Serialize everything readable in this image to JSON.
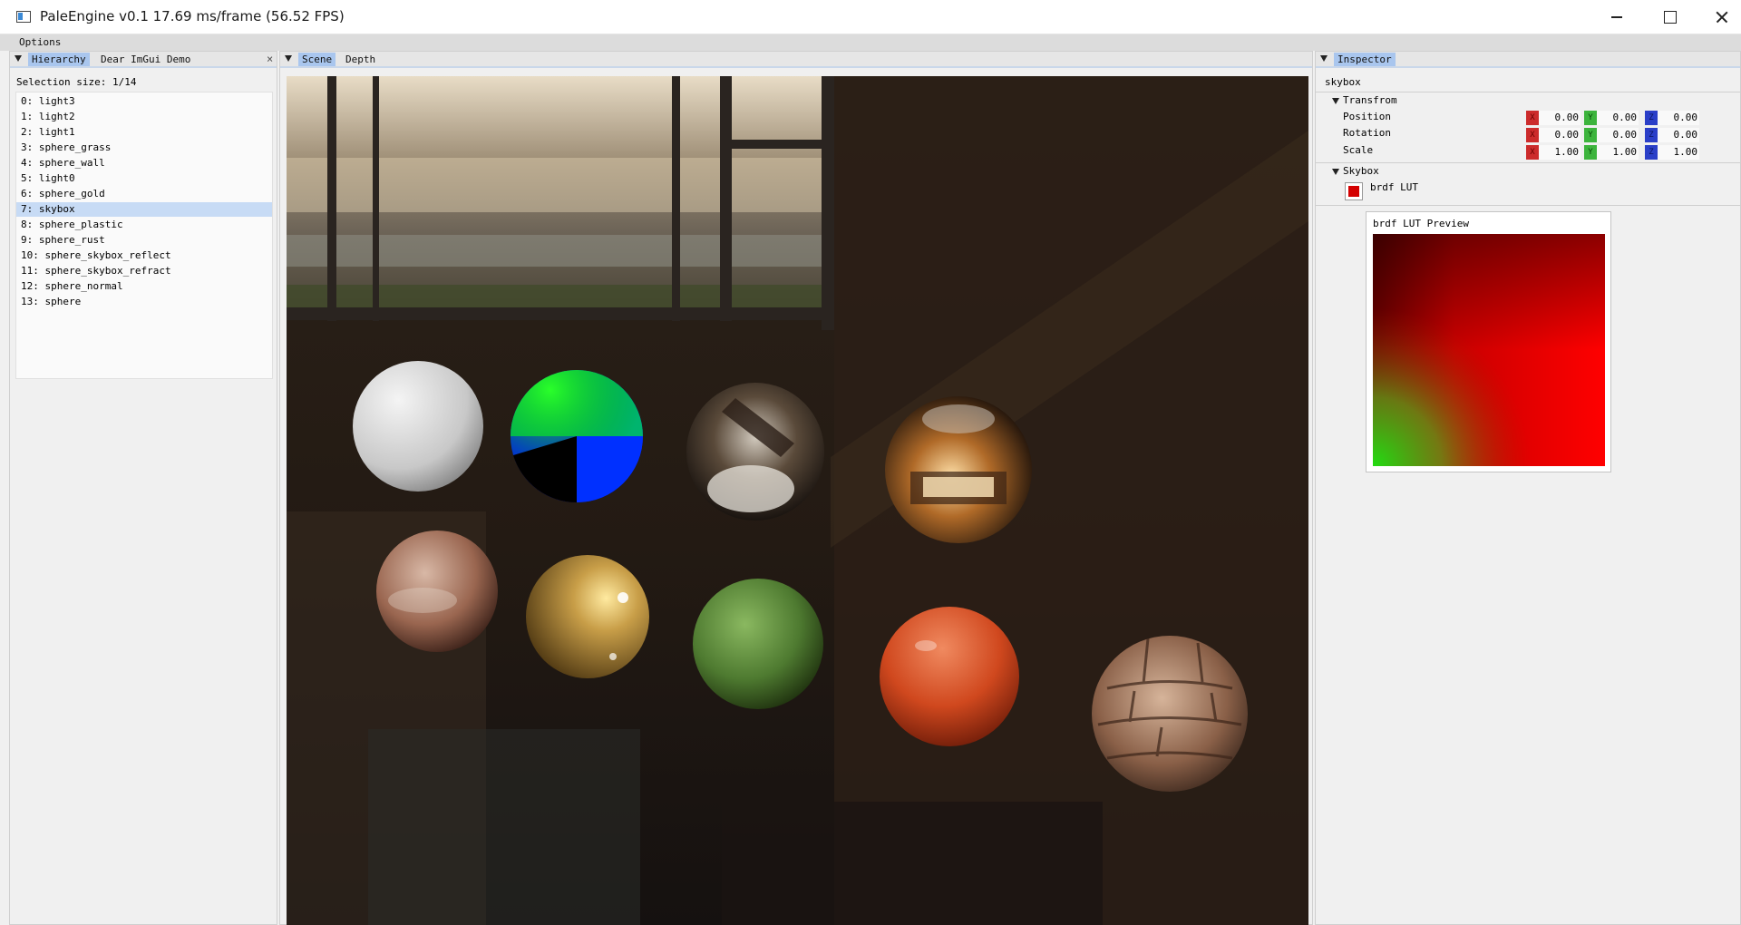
{
  "window": {
    "title": "PaleEngine v0.1 17.69 ms/frame (56.52 FPS)"
  },
  "menu": {
    "options": "Options"
  },
  "hierarchy_panel": {
    "tabs": [
      "Hierarchy",
      "Dear ImGui Demo"
    ],
    "selection_size": "Selection size: 1/14",
    "items": [
      "0: light3",
      "1: light2",
      "2: light1",
      "3: sphere_grass",
      "4: sphere_wall",
      "5: light0",
      "6: sphere_gold",
      "7: skybox",
      "8: sphere_plastic",
      "9: sphere_rust",
      "10: sphere_skybox_reflect",
      "11: sphere_skybox_refract",
      "12: sphere_normal",
      "13: sphere"
    ],
    "selected_index": 7
  },
  "scene_panel": {
    "tabs": [
      "Scene",
      "Depth"
    ],
    "active_tab": "Scene"
  },
  "inspector": {
    "tab": "Inspector",
    "object_name": "skybox",
    "transform": {
      "header": "Transfrom",
      "rows": [
        {
          "label": "Position",
          "x": "0.00",
          "y": "0.00",
          "z": "0.00"
        },
        {
          "label": "Rotation",
          "x": "0.00",
          "y": "0.00",
          "z": "0.00"
        },
        {
          "label": "Scale",
          "x": "1.00",
          "y": "1.00",
          "z": "1.00"
        }
      ],
      "axis_tags": {
        "x": "X",
        "y": "Y",
        "z": "Z"
      }
    },
    "skybox": {
      "header": "Skybox",
      "texture_label": "brdf LUT",
      "preview_title": "brdf LUT Preview"
    }
  },
  "colors": {
    "accent": "#a9c6ee",
    "selection": "#c7dbf5",
    "axis_x": "#cc2b2b",
    "axis_y": "#3cb43c",
    "axis_z": "#2a3fc8"
  }
}
